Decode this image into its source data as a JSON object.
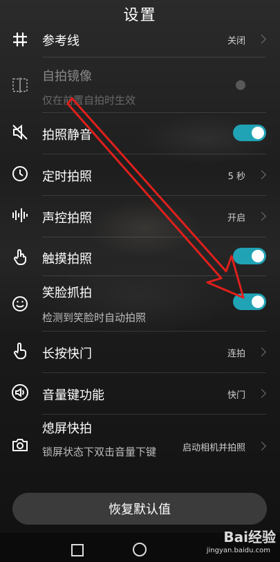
{
  "header": {
    "title": "设置"
  },
  "rows": [
    {
      "label": "参考线",
      "value": "关闭"
    },
    {
      "label": "自拍镜像",
      "sub": "仅在前置自拍时生效"
    },
    {
      "label": "拍照静音"
    },
    {
      "label": "定时拍照",
      "value": "5 秒"
    },
    {
      "label": "声控拍照",
      "value": "开启"
    },
    {
      "label": "触摸拍照"
    },
    {
      "label": "笑脸抓拍",
      "sub": "检测到笑脸时自动拍照"
    },
    {
      "label": "长按快门",
      "value": "连拍"
    },
    {
      "label": "音量键功能",
      "value": "快门"
    },
    {
      "label": "熄屏快拍",
      "sub": "锁屏状态下双击音量下键",
      "value": "启动相机并拍照"
    }
  ],
  "toggles": {
    "mute": true,
    "touch": true,
    "smile": true,
    "mirror": false
  },
  "restore_label": "恢复默认值",
  "watermark": {
    "brand": "Bai经验",
    "url": "jingyan.baidu.com"
  },
  "colors": {
    "accent": "#1fa3b5",
    "arrow": "#e0201c"
  }
}
